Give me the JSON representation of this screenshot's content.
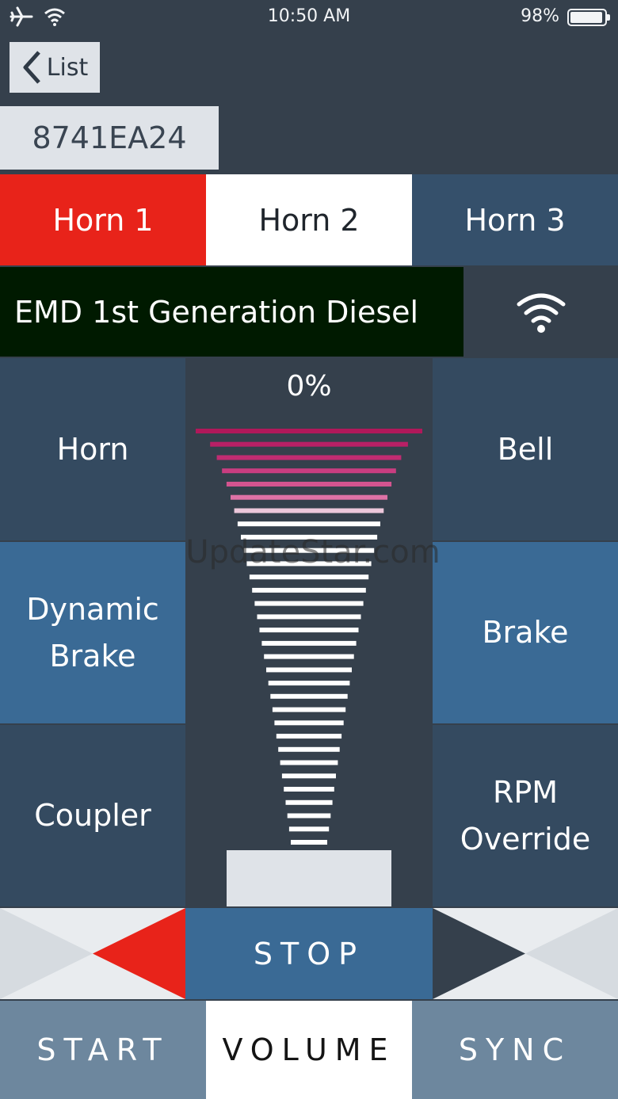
{
  "status_bar": {
    "time": "10:50 AM",
    "battery_percent": "98%",
    "battery_level": 0.98,
    "icons": [
      "airplane-icon",
      "wifi-icon",
      "battery-icon"
    ]
  },
  "nav": {
    "back_label": "List",
    "device_id": "8741EA24"
  },
  "horn_tabs": [
    {
      "label": "Horn 1",
      "selected": true
    },
    {
      "label": "Horn 2",
      "selected": false
    },
    {
      "label": "Horn 3",
      "selected": false
    }
  ],
  "locomotive": {
    "name": "EMD 1st Generation Diesel",
    "connection_icon": "wifi-signal-icon"
  },
  "functions": {
    "horn": "Horn",
    "dynamic_brake_line1": "Dynamic",
    "dynamic_brake_line2": "Brake",
    "coupler": "Coupler",
    "bell": "Bell",
    "brake": "Brake",
    "rpm_override_line1": "RPM",
    "rpm_override_line2": "Override"
  },
  "throttle": {
    "percent_label": "0%",
    "level": 0.0
  },
  "direction": {
    "stop_label": "STOP",
    "reverse_icon": "left-arrow-icon",
    "forward_icon": "right-arrow-icon"
  },
  "bottom_tabs": [
    {
      "label": "START",
      "selected": false
    },
    {
      "label": "VOLUME",
      "selected": true
    },
    {
      "label": "SYNC",
      "selected": false
    }
  ],
  "colors": {
    "background": "#35404c",
    "accent_red": "#e8231a",
    "tile_dark": "#344a60",
    "tile_mid": "#3a6a95",
    "loco_bar": "#001a00",
    "magenta_bar": "#b0185a"
  },
  "watermark": "UpdateStar.com"
}
